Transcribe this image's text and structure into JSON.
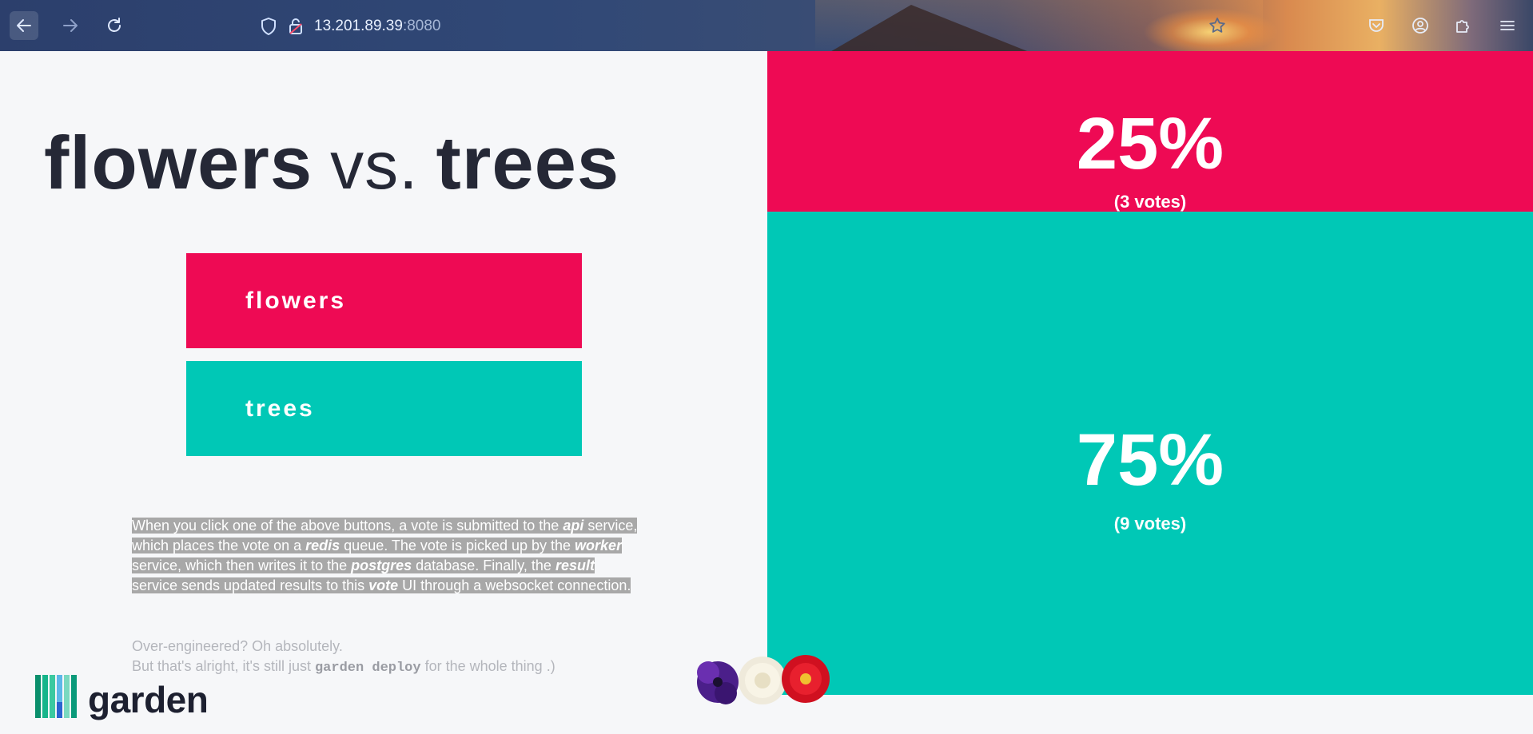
{
  "browser": {
    "url_host": "13.201.89.39",
    "url_port": ":8080",
    "icons": [
      "back-arrow-icon",
      "forward-arrow-icon",
      "reload-icon",
      "shield-icon",
      "lock-icon",
      "bookmark-star-icon",
      "pocket-icon",
      "account-icon",
      "extensions-icon",
      "menu-icon"
    ]
  },
  "vote": {
    "headline_left": "flowers",
    "headline_vs": "vs.",
    "headline_right": "trees",
    "option_a": "flowers",
    "option_b": "trees",
    "description_parts": [
      "When you click one of the above buttons, a vote is submitted to the ",
      "api",
      " service, which places the vote on a ",
      "redis",
      " queue. The vote is picked up by the ",
      "worker",
      " service, which then writes it to the ",
      "postgres",
      " database. Finally, the ",
      "result",
      " service sends updated results to this ",
      "vote",
      " UI through a websocket connection. "
    ],
    "note_line1": "Over-engineered? Oh absolutely.",
    "note_line2_before": "But that's alright, it's still just ",
    "note_line2_code": "garden deploy",
    "note_line2_after": " for the whole thing .)",
    "logo_text": "garden"
  },
  "results": {
    "a": {
      "percent": "25%",
      "votes": "(3 votes)",
      "color": "#ee0a54"
    },
    "b": {
      "percent": "75%",
      "votes": "(9 votes)",
      "color": "#00c8b6"
    }
  },
  "colors": {
    "accent_a": "#ee0a54",
    "accent_b": "#00c8b6",
    "text_dark": "#252836",
    "page_bg": "#f6f7f9"
  }
}
